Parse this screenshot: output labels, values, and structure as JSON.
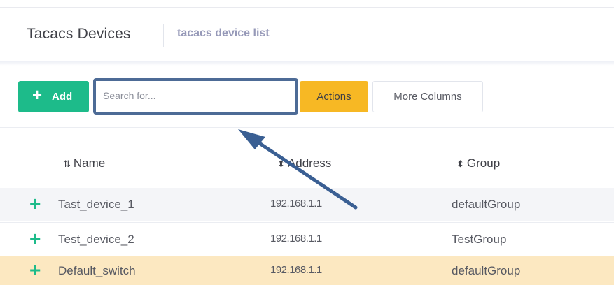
{
  "header": {
    "title": "Tacacs Devices",
    "subtitle": "tacacs device list"
  },
  "toolbar": {
    "add_label": "Add",
    "search_placeholder": "Search for...",
    "actions_label": "Actions",
    "more_columns_label": "More Columns"
  },
  "table": {
    "columns": [
      {
        "label": "Name",
        "sort_icon": "sort-amount-icon"
      },
      {
        "label": "Address",
        "sort_icon": "sort-icon"
      },
      {
        "label": "Group",
        "sort_icon": "sort-icon"
      }
    ],
    "rows": [
      {
        "name": "Tast_device_1",
        "address": "192.168.1.1",
        "group": "defaultGroup"
      },
      {
        "name": "Test_device_2",
        "address": "192.168.1.1",
        "group": "TestGroup"
      },
      {
        "name": "Default_switch",
        "address": "192.168.1.1",
        "group": "defaultGroup",
        "highlighted": true
      }
    ]
  },
  "colors": {
    "add": "#1dbb8a",
    "actions": "#f7b824",
    "highlight_row": "#fce8c1",
    "annotation": "#4d6b96"
  }
}
